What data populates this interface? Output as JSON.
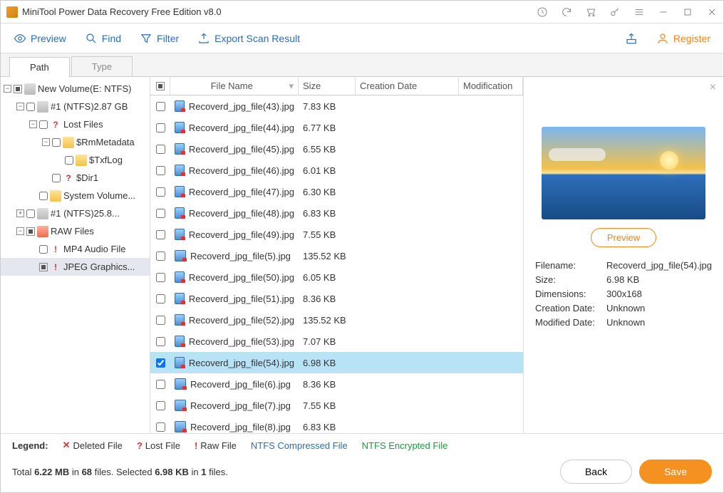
{
  "app_title": "MiniTool Power Data Recovery Free Edition v8.0",
  "toolbar": {
    "preview": "Preview",
    "find": "Find",
    "filter": "Filter",
    "export": "Export Scan Result",
    "register": "Register"
  },
  "tabs": {
    "path": "Path",
    "type": "Type"
  },
  "tree": {
    "root": "New Volume(E: NTFS)",
    "n1": "#1 (NTFS)2.87 GB",
    "lost": "Lost Files",
    "rmm": "$RmMetadata",
    "txf": "$TxfLog",
    "dir1": "$Dir1",
    "sysvol": "System Volume...",
    "n2": "#1 (NTFS)25.8...",
    "raw": "RAW Files",
    "mp4": "MP4 Audio File",
    "jpeg": "JPEG Graphics..."
  },
  "columns": {
    "name": "File Name",
    "size": "Size",
    "cdate": "Creation Date",
    "mod": "Modification"
  },
  "files": [
    {
      "name": "Recoverd_jpg_file(43).jpg",
      "size": "7.83 KB",
      "sel": false
    },
    {
      "name": "Recoverd_jpg_file(44).jpg",
      "size": "6.77 KB",
      "sel": false
    },
    {
      "name": "Recoverd_jpg_file(45).jpg",
      "size": "6.55 KB",
      "sel": false
    },
    {
      "name": "Recoverd_jpg_file(46).jpg",
      "size": "6.01 KB",
      "sel": false
    },
    {
      "name": "Recoverd_jpg_file(47).jpg",
      "size": "6.30 KB",
      "sel": false
    },
    {
      "name": "Recoverd_jpg_file(48).jpg",
      "size": "6.83 KB",
      "sel": false
    },
    {
      "name": "Recoverd_jpg_file(49).jpg",
      "size": "7.55 KB",
      "sel": false
    },
    {
      "name": "Recoverd_jpg_file(5).jpg",
      "size": "135.52 KB",
      "sel": false
    },
    {
      "name": "Recoverd_jpg_file(50).jpg",
      "size": "6.05 KB",
      "sel": false
    },
    {
      "name": "Recoverd_jpg_file(51).jpg",
      "size": "8.36 KB",
      "sel": false
    },
    {
      "name": "Recoverd_jpg_file(52).jpg",
      "size": "135.52 KB",
      "sel": false
    },
    {
      "name": "Recoverd_jpg_file(53).jpg",
      "size": "7.07 KB",
      "sel": false
    },
    {
      "name": "Recoverd_jpg_file(54).jpg",
      "size": "6.98 KB",
      "sel": true
    },
    {
      "name": "Recoverd_jpg_file(6).jpg",
      "size": "8.36 KB",
      "sel": false
    },
    {
      "name": "Recoverd_jpg_file(7).jpg",
      "size": "7.55 KB",
      "sel": false
    },
    {
      "name": "Recoverd_jpg_file(8).jpg",
      "size": "6.83 KB",
      "sel": false
    }
  ],
  "preview": {
    "button": "Preview",
    "filename_k": "Filename:",
    "filename_v": "Recoverd_jpg_file(54).jpg",
    "size_k": "Size:",
    "size_v": "6.98 KB",
    "dim_k": "Dimensions:",
    "dim_v": "300x168",
    "cdate_k": "Creation Date:",
    "cdate_v": "Unknown",
    "mdate_k": "Modified Date:",
    "mdate_v": "Unknown"
  },
  "legend": {
    "label": "Legend:",
    "deleted": "Deleted File",
    "lost": "Lost File",
    "raw": "Raw File",
    "ntfsc": "NTFS Compressed File",
    "ntfse": "NTFS Encrypted File"
  },
  "status": {
    "total_prefix": "Total ",
    "total_size": "6.22 MB",
    "in1": " in ",
    "total_count": "68",
    "files1": " files.  Selected ",
    "sel_size": "6.98 KB",
    "in2": " in ",
    "sel_count": "1",
    "files2": " files."
  },
  "buttons": {
    "back": "Back",
    "save": "Save"
  }
}
